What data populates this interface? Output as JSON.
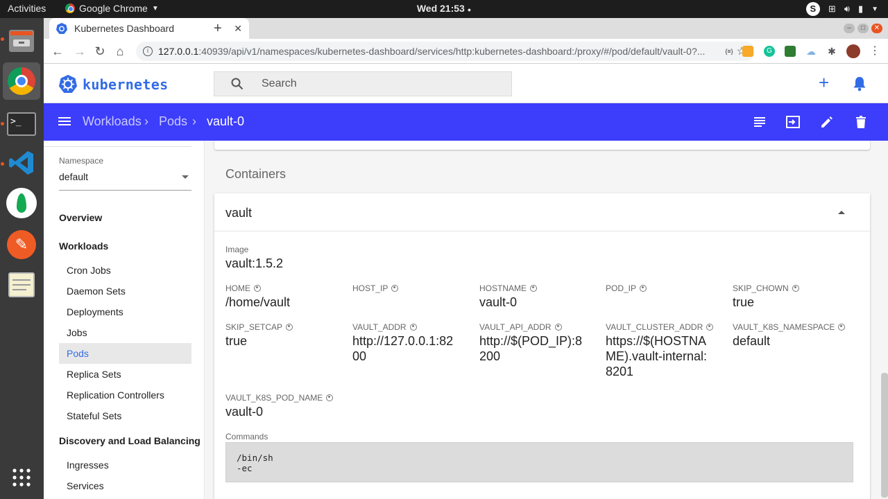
{
  "os": {
    "activities": "Activities",
    "app_name": "Google Chrome",
    "clock": "Wed 21:53"
  },
  "browser": {
    "tab_title": "Kubernetes Dashboard",
    "new_tab": "+",
    "url_host": "127.0.0.1",
    "url_rest": ":40939/api/v1/namespaces/kubernetes-dashboard/services/http:kubernetes-dashboard:/proxy/#/pod/default/vault-0?..."
  },
  "header": {
    "brand": "kubernetes",
    "search_placeholder": "Search"
  },
  "breadcrumb": {
    "workloads": "Workloads",
    "pods": "Pods",
    "current": "vault-0"
  },
  "sidebar": {
    "namespace_label": "Namespace",
    "namespace_value": "default",
    "overview": "Overview",
    "workloads": "Workloads",
    "workload_items": [
      "Cron Jobs",
      "Daemon Sets",
      "Deployments",
      "Jobs",
      "Pods",
      "Replica Sets",
      "Replication Controllers",
      "Stateful Sets"
    ],
    "discovery": "Discovery and Load Balancing",
    "discovery_items": [
      "Ingresses",
      "Services"
    ]
  },
  "main": {
    "section_title": "Containers",
    "container_name": "vault",
    "image_label": "Image",
    "image_value": "vault:1.5.2",
    "env": [
      {
        "name": "HOME",
        "value": "/home/vault"
      },
      {
        "name": "HOST_IP",
        "value": ""
      },
      {
        "name": "HOSTNAME",
        "value": "vault-0"
      },
      {
        "name": "POD_IP",
        "value": ""
      },
      {
        "name": "SKIP_CHOWN",
        "value": "true"
      },
      {
        "name": "SKIP_SETCAP",
        "value": "true"
      },
      {
        "name": "VAULT_ADDR",
        "value": "http://127.0.0.1:8200"
      },
      {
        "name": "VAULT_API_ADDR",
        "value": "http://$(POD_IP):8200"
      },
      {
        "name": "VAULT_CLUSTER_ADDR",
        "value": "https://$(HOSTNAME).vault-internal:8201"
      },
      {
        "name": "VAULT_K8S_NAMESPACE",
        "value": "default"
      },
      {
        "name": "VAULT_K8S_POD_NAME",
        "value": "vault-0"
      }
    ],
    "commands_label": "Commands",
    "commands": [
      "/bin/sh",
      "-ec"
    ]
  },
  "colors": {
    "brand_blue": "#326ce5",
    "toolbar_blue": "#3d3dfc"
  }
}
